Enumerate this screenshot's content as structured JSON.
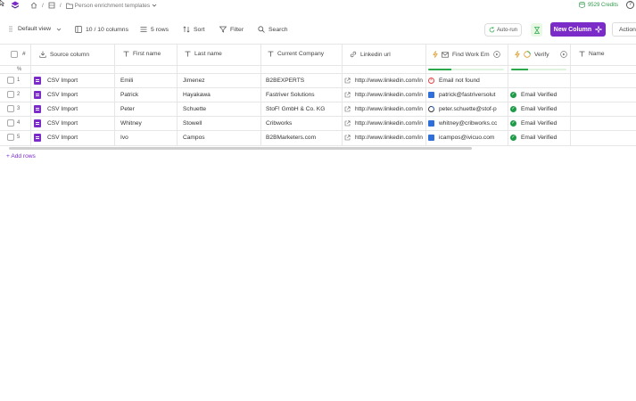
{
  "breadcrumb": {
    "separator": "/",
    "folder": "Person enrichment templates"
  },
  "credits": {
    "amount": "9529 Credits"
  },
  "help": {
    "label": "?"
  },
  "toolbar": {
    "view": "Default view",
    "columns": "10 / 10 columns",
    "rows": "5 rows",
    "sort": "Sort",
    "filter": "Filter",
    "search": "Search",
    "autorun": "Auto-run",
    "new_column": "New Column",
    "action": "Action"
  },
  "table": {
    "headers": {
      "index": "#",
      "source": "Source column",
      "first": "First name",
      "last": "Last name",
      "company": "Current Company",
      "linkedin": "Linkedin url",
      "findemail": "Find Work Em",
      "verify": "Verify",
      "name": "Name"
    },
    "subheader": {
      "percent": "%"
    },
    "progress": {
      "findemail": 0.3,
      "verify": 0.3
    },
    "rows": [
      {
        "num": "1",
        "source": "CSV Import",
        "first": "Emili",
        "last": "Jimenez",
        "company": "B2BEXPERTS",
        "linkedin": "http://www.linkedin.com/in",
        "email": "Email not found",
        "email_status": "fail",
        "verify": ""
      },
      {
        "num": "2",
        "source": "CSV Import",
        "first": "Patrick",
        "last": "Hayakawa",
        "company": "Fastriver Solutions",
        "linkedin": "http://www.linkedin.com/in",
        "email": "patrick@fastriversolut",
        "email_status": "found",
        "verify": "Email Verified"
      },
      {
        "num": "3",
        "source": "CSV Import",
        "first": "Peter",
        "last": "Schuette",
        "company": "StoF! GmbH & Co. KG",
        "linkedin": "http://www.linkedin.com/in",
        "email": "peter.schuette@stof-p",
        "email_status": "found-alt",
        "verify": "Email Verified"
      },
      {
        "num": "4",
        "source": "CSV Import",
        "first": "Whitney",
        "last": "Stowell",
        "company": "Cribworks",
        "linkedin": "http://www.linkedin.com/in",
        "email": "whitney@cribworks.cc",
        "email_status": "found",
        "verify": "Email Verified"
      },
      {
        "num": "5",
        "source": "CSV Import",
        "first": "Ivo",
        "last": "Campos",
        "company": "B2BMarketers.com",
        "linkedin": "http://www.linkedin.com/in",
        "email": "icampos@ivicuo.com",
        "email_status": "found",
        "verify": "Email Verified"
      }
    ],
    "add_rows": "+ Add rows"
  },
  "colors": {
    "accent": "#7a2bc8",
    "success": "#1e9b47",
    "error": "#e04848",
    "email_icon": "#2f6fd9"
  }
}
